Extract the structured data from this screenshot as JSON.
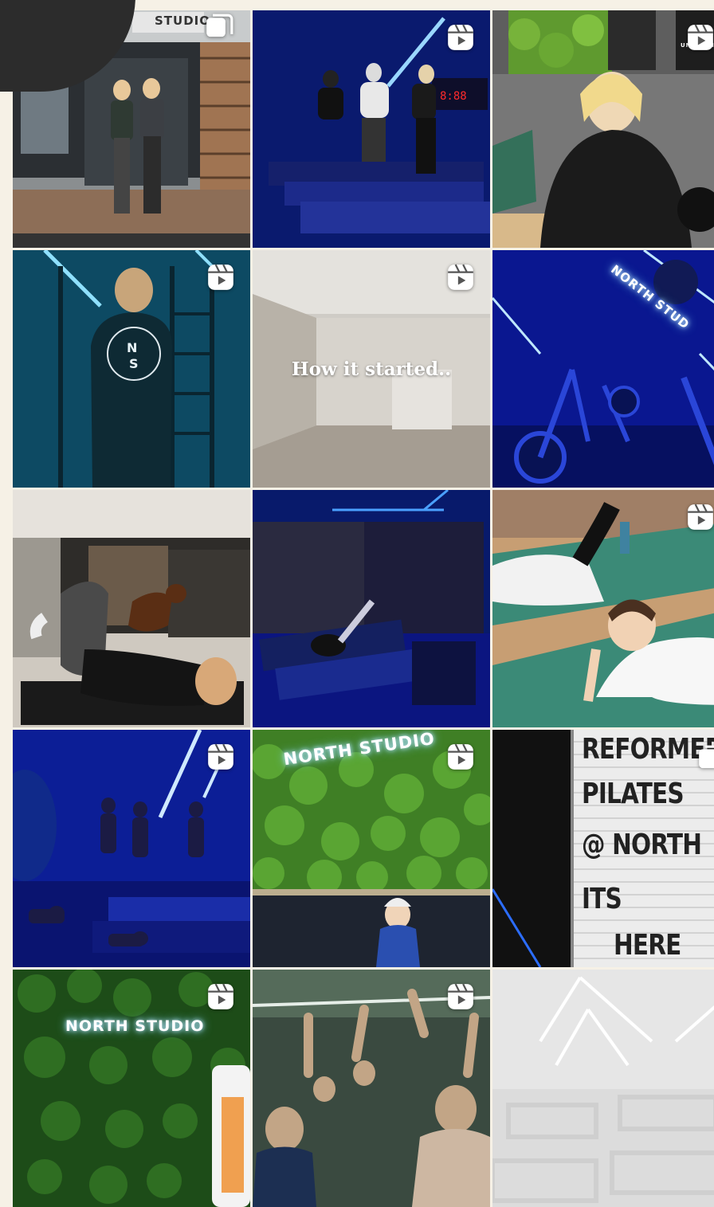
{
  "posts": [
    {
      "type": "carousel",
      "scene": "storefront",
      "sign": "STUDIO"
    },
    {
      "type": "reel",
      "scene": "treadmills-blue"
    },
    {
      "type": "reel",
      "scene": "woman-sofa",
      "sign": "UNDER HER"
    },
    {
      "type": "reel",
      "scene": "back-ns-logo"
    },
    {
      "type": "reel",
      "scene": "empty-room",
      "caption": "How it started.."
    },
    {
      "type": "reel",
      "scene": "bikes-neon",
      "sign": "NORTH STUD"
    },
    {
      "type": "none",
      "scene": "dog-reformer"
    },
    {
      "type": "none",
      "scene": "reformer-blue"
    },
    {
      "type": "reel",
      "scene": "mat-class"
    },
    {
      "type": "reel",
      "scene": "class-blue"
    },
    {
      "type": "reel",
      "scene": "moss-wall",
      "sign": "NORTH STUDIO"
    },
    {
      "type": "carousel",
      "scene": "letterboard",
      "board": [
        "REFORMER",
        "PILATES",
        "@ NORTH",
        "ITS",
        "HERE"
      ]
    },
    {
      "type": "reel",
      "scene": "moss-neon",
      "sign": "NORTH STUDIO"
    },
    {
      "type": "reel",
      "scene": "spin-class"
    },
    {
      "type": "none",
      "scene": "white-studio"
    }
  ],
  "colors": {
    "background": "#f6f1e6",
    "neon_blue": "#1a3cff",
    "moss_green": "#4f9a2a"
  },
  "icons": {
    "reel": "reel-icon",
    "carousel": "carousel-icon"
  }
}
